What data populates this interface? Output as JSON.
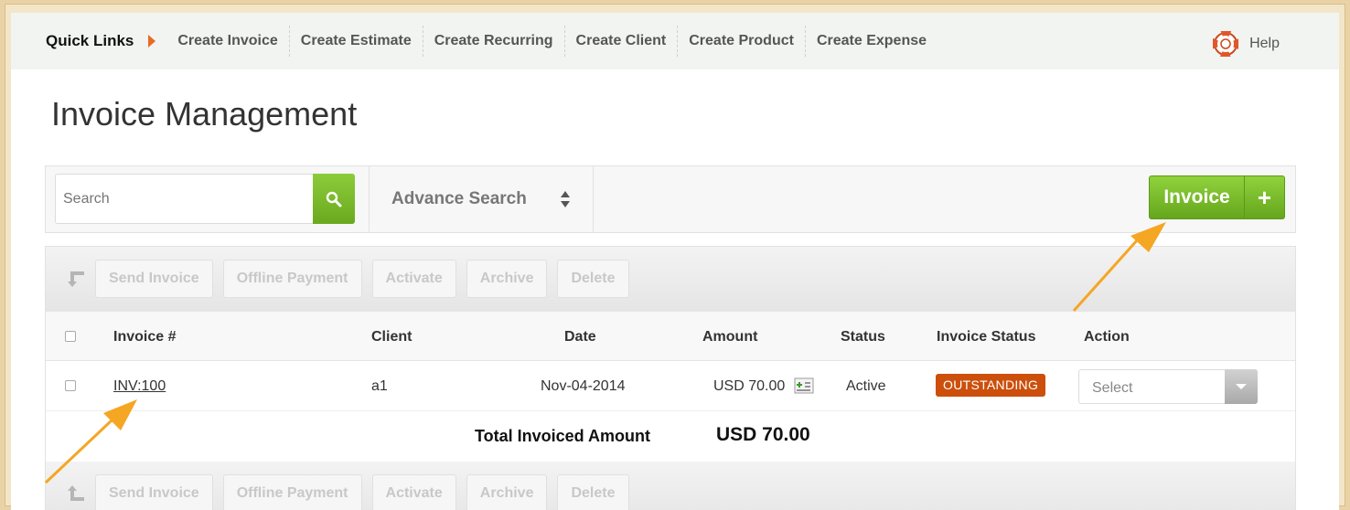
{
  "quick_links": {
    "title": "Quick Links",
    "links": [
      "Create Invoice",
      "Create Estimate",
      "Create Recurring",
      "Create Client",
      "Create Product",
      "Create Expense"
    ],
    "help_label": "Help"
  },
  "page": {
    "title": "Invoice Management"
  },
  "toolbar": {
    "search_placeholder": "Search",
    "advance_search_label": "Advance Search",
    "new_invoice_label": "Invoice",
    "new_invoice_plus": "+"
  },
  "actions": [
    "Send Invoice",
    "Offline Payment",
    "Activate",
    "Archive",
    "Delete"
  ],
  "table": {
    "headers": {
      "invoice": "Invoice #",
      "client": "Client",
      "date": "Date",
      "amount": "Amount",
      "status": "Status",
      "invoice_status": "Invoice Status",
      "action": "Action"
    },
    "rows": [
      {
        "invoice": "INV:100",
        "client": "a1",
        "date": "Nov-04-2014",
        "amount": "USD 70.00",
        "status": "Active",
        "invoice_status": "OUTSTANDING",
        "action_select": "Select"
      }
    ],
    "total_label": "Total Invoiced Amount",
    "total_value": "USD 70.00"
  },
  "colors": {
    "accent_green": "#76b52a",
    "badge_orange": "#cc4f0c",
    "annotation_arrow": "#f5a623"
  }
}
